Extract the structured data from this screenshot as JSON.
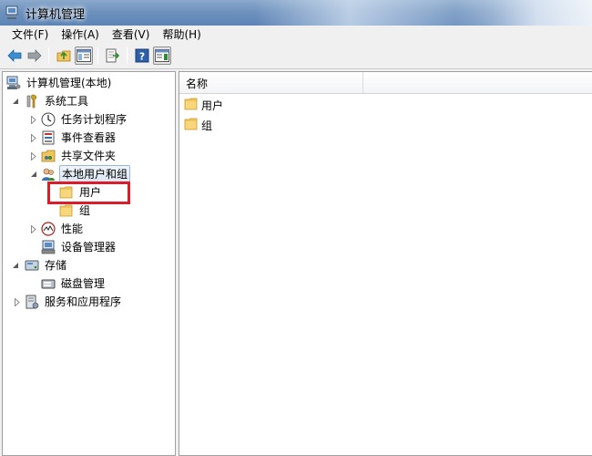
{
  "window": {
    "title": "计算机管理"
  },
  "menu": {
    "items": [
      "文件(F)",
      "操作(A)",
      "查看(V)",
      "帮助(H)"
    ]
  },
  "tree": {
    "root": "计算机管理(本地)",
    "system_tools": "系统工具",
    "task_scheduler": "任务计划程序",
    "event_viewer": "事件查看器",
    "shared_folders": "共享文件夹",
    "local_users_groups": "本地用户和组",
    "users": "用户",
    "groups": "组",
    "performance": "性能",
    "device_manager": "设备管理器",
    "storage": "存储",
    "disk_management": "磁盘管理",
    "services_apps": "服务和应用程序"
  },
  "list": {
    "column_name": "名称",
    "rows": [
      "用户",
      "组"
    ]
  },
  "colors": {
    "highlight_border": "#d81e2b",
    "folder": "#f2c55c"
  }
}
